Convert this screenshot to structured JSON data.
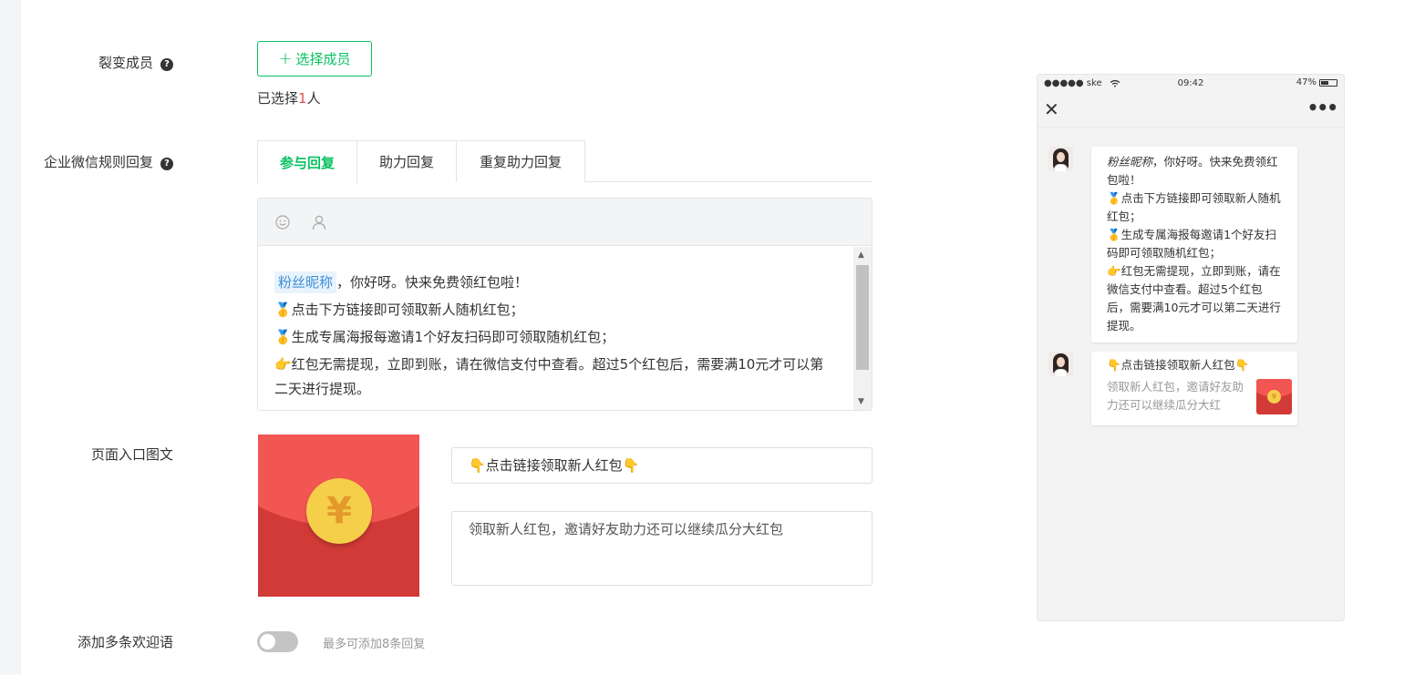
{
  "form": {
    "members_label": "裂变成员",
    "select_members_button": "选择成员",
    "selected_prefix": "已选择",
    "selected_count": "1",
    "selected_suffix": "人",
    "rules_label": "企业微信规则回复",
    "tabs": [
      {
        "label": "参与回复",
        "active": true
      },
      {
        "label": "助力回复",
        "active": false
      },
      {
        "label": "重复助力回复",
        "active": false
      }
    ],
    "toolbar_icons": [
      "smile-icon",
      "user-icon"
    ],
    "editor": {
      "nickname_tag": "粉丝昵称",
      "line1_rest": "，你好呀。快来免费领红包啦！",
      "line2": "🥇点击下方链接即可领取新人随机红包；",
      "line3": "🥇生成专属海报每邀请1个好友扫码即可领取随机红包；",
      "line4": "👉红包无需提现，立即到账，请在微信支付中查看。超过5个红包后，需要满10元才可以第二天进行提现。"
    },
    "entry_label": "页面入口图文",
    "entry_title": "👇点击链接领取新人红包👇",
    "entry_desc": "领取新人红包，邀请好友助力还可以继续瓜分大红包",
    "cover_symbol": "¥",
    "welcome_label": "添加多条欢迎语",
    "welcome_toggle_on": false,
    "welcome_hint": "最多可添加8条回复"
  },
  "preview": {
    "status_carrier": "●●●●● ske",
    "status_time": "09:42",
    "status_battery": "47%",
    "message1": {
      "nickname": "粉丝昵称",
      "text": "，你好呀。快来免费领红包啦！",
      "line2": "🥇点击下方链接即可领取新人随机红包；",
      "line3": "🥇生成专属海报每邀请1个好友扫码即可领取随机红包；",
      "line4": "👉红包无需提现，立即到账，请在微信支付中查看。超过5个红包后，需要满10元才可以第二天进行提现。"
    },
    "message2": {
      "title": "👇点击链接领取新人红包👇",
      "desc": "领取新人红包，邀请好友助力还可以继续瓜分大红",
      "cover_symbol": "¥"
    }
  },
  "colors": {
    "accent": "#07c160",
    "count_highlight": "#e05050",
    "nickname_tag_bg": "#e8f3fc",
    "nickname_tag_text": "#3d8fd6",
    "redpacket": "#d13a37",
    "coin": "#f5cf4a"
  }
}
